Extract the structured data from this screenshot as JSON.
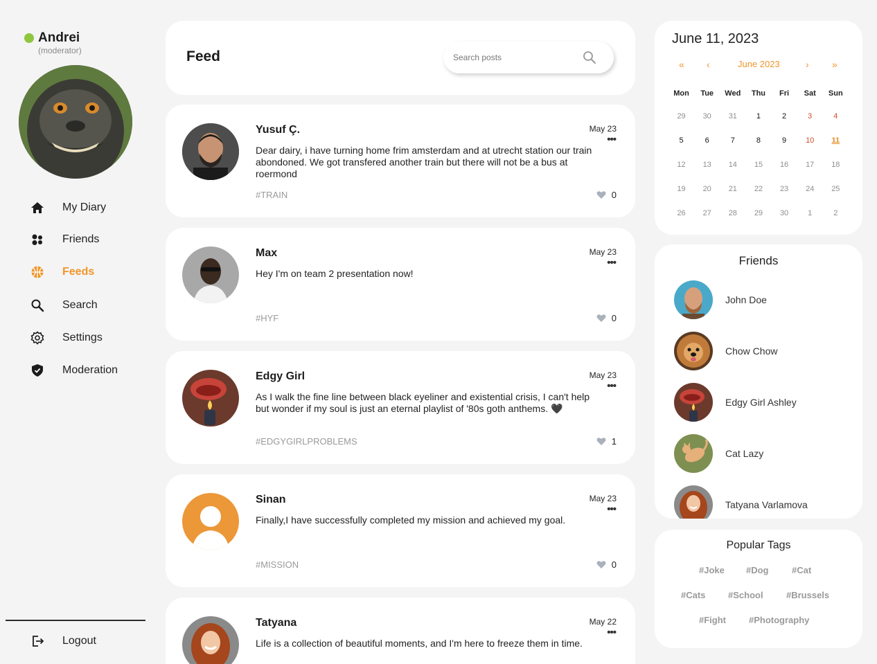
{
  "user": {
    "name": "Andrei",
    "role": "(moderator)",
    "status_color": "#8ec63f"
  },
  "nav": {
    "items": [
      {
        "label": "My Diary",
        "icon": "home-icon"
      },
      {
        "label": "Friends",
        "icon": "people-icon"
      },
      {
        "label": "Feeds",
        "icon": "basketball-icon",
        "active": true
      },
      {
        "label": "Search",
        "icon": "search-icon"
      },
      {
        "label": "Settings",
        "icon": "gear-icon"
      },
      {
        "label": "Moderation",
        "icon": "shield-icon"
      }
    ],
    "logout": {
      "label": "Logout",
      "icon": "logout-icon"
    }
  },
  "feed": {
    "title": "Feed",
    "search_placeholder": "Search posts",
    "posts": [
      {
        "author": "Yusuf Ç.",
        "date": "May 23",
        "text": "Dear dairy, i have turning home frim amsterdam and at utrecht station our train abondoned. We got transfered another train but there will not be a bus at roermond",
        "tag": "#TRAIN",
        "likes": "0"
      },
      {
        "author": "Max",
        "date": "May 23",
        "text": "Hey I'm on team 2 presentation now!",
        "tag": "#HYF",
        "likes": "0"
      },
      {
        "author": "Edgy Girl",
        "date": "May 23",
        "text": "As I walk the fine line between black eyeliner and existential crisis, I can't help but wonder if my soul is just an eternal playlist of '80s goth anthems. 🖤",
        "tag": "#EDGYGIRLPROBLEMS",
        "likes": "1"
      },
      {
        "author": "Sinan",
        "date": "May 23",
        "text": "Finally,I have successfully completed my mission and achieved my goal.",
        "tag": "#MISSION",
        "likes": "0"
      },
      {
        "author": "Tatyana",
        "date": "May 22",
        "text": "Life is a collection of beautiful moments, and I'm here to freeze them in time.",
        "tag": "",
        "likes": ""
      }
    ]
  },
  "calendar": {
    "date": "June 11, 2023",
    "month_label": "June 2023",
    "nav": {
      "prev_year": "«",
      "prev_month": "‹",
      "next_month": "›",
      "next_year": "»"
    },
    "weekdays": [
      "Mon",
      "Tue",
      "Wed",
      "Thu",
      "Fri",
      "Sat",
      "Sun"
    ],
    "weeks": [
      [
        "29",
        "30",
        "31",
        "1",
        "2",
        "3",
        "4"
      ],
      [
        "5",
        "6",
        "7",
        "8",
        "9",
        "10",
        "11"
      ],
      [
        "12",
        "13",
        "14",
        "15",
        "16",
        "17",
        "18"
      ],
      [
        "19",
        "20",
        "21",
        "22",
        "23",
        "24",
        "25"
      ],
      [
        "26",
        "27",
        "28",
        "29",
        "30",
        "1",
        "2"
      ]
    ],
    "accent_color": "#f0952c",
    "weekend_color": "#d14a2b"
  },
  "friends": {
    "title": "Friends",
    "list": [
      {
        "name": "John Doe"
      },
      {
        "name": "Chow Chow"
      },
      {
        "name": "Edgy Girl Ashley"
      },
      {
        "name": "Cat Lazy"
      },
      {
        "name": "Tatyana Varlamova"
      }
    ]
  },
  "popular_tags": {
    "title": "Popular Tags",
    "tags": [
      "#Joke",
      "#Dog",
      "#Cat",
      "#Cats",
      "#School",
      "#Brussels",
      "#Fight",
      "#Photography"
    ]
  }
}
